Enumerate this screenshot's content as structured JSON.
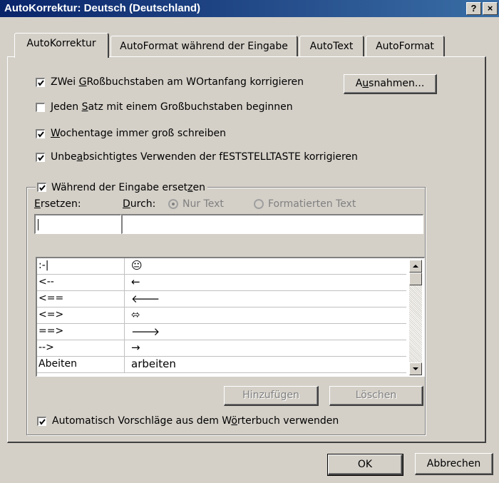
{
  "window": {
    "title": "AutoKorrektur: Deutsch (Deutschland)",
    "help_glyph": "?",
    "close_glyph": "×"
  },
  "tabs": [
    {
      "label": "AutoKorrektur",
      "active": true
    },
    {
      "label": "AutoFormat während der Eingabe",
      "active": false
    },
    {
      "label": "AutoText",
      "active": false
    },
    {
      "label": "AutoFormat",
      "active": false
    }
  ],
  "options": [
    {
      "label_pre": "ZWei ",
      "accel": "G",
      "label_post": "Roßbuchstaben am WOrtanfang korrigieren",
      "checked": true
    },
    {
      "label_pre": "Jeden ",
      "accel": "S",
      "label_post": "atz mit einem Großbuchstaben beginnen",
      "checked": false
    },
    {
      "label_pre": "",
      "accel": "W",
      "label_post": "ochentage immer groß schreiben",
      "checked": true
    },
    {
      "label_pre": "Unbe",
      "accel": "a",
      "label_post": "bsichtigtes Verwenden der fESTSTELLTASTE korrigieren",
      "checked": true
    }
  ],
  "exceptions_button": {
    "pre": "A",
    "accel": "u",
    "post": "snahmen..."
  },
  "replace_group": {
    "checkbox": {
      "pre": "Während der Eingabe erset",
      "accel": "z",
      "post": "en",
      "checked": true
    },
    "replace_label": {
      "pre": "",
      "accel": "E",
      "post": "rsetzen:"
    },
    "with_label": {
      "pre": "",
      "accel": "D",
      "post": "urch:"
    },
    "radio_plain": "Nur Text",
    "radio_formatted": "Formatierten Text",
    "replace_value": "",
    "with_value": "",
    "entries": [
      {
        "from": ":-|",
        "to": "😐"
      },
      {
        "from": "<--",
        "to": "←"
      },
      {
        "from": "<==",
        "to": "🡐"
      },
      {
        "from": "<=>",
        "to": "⬄"
      },
      {
        "from": "==>",
        "to": "🡒"
      },
      {
        "from": "-->",
        "to": "→"
      },
      {
        "from": "Abeiten",
        "to": "arbeiten"
      }
    ],
    "add_button": "Hinzufügen",
    "delete_button": "Löschen",
    "suggest_checkbox": {
      "pre": "Automatisch Vorschläge aus dem W",
      "accel": "ö",
      "post": "rterbuch verwenden",
      "checked": true
    }
  },
  "footer": {
    "ok": "OK",
    "cancel": "Abbrechen"
  }
}
